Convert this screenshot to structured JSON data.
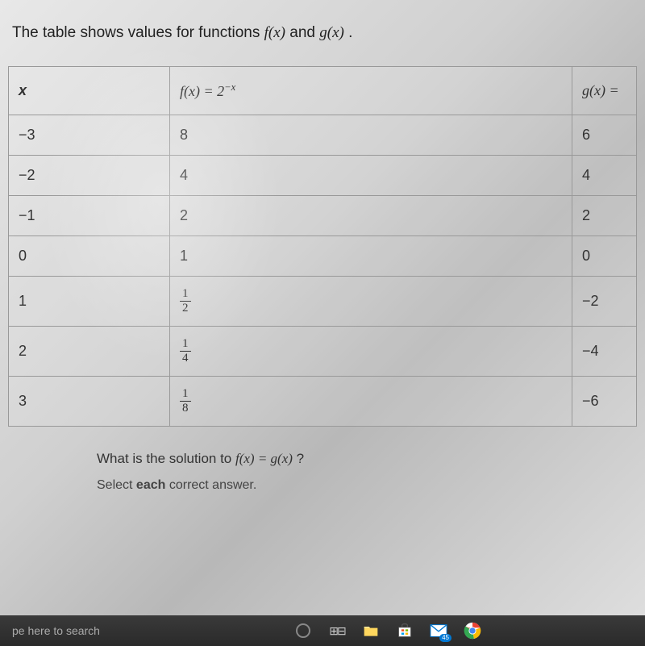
{
  "prompt": {
    "prefix": "The table shows values for functions ",
    "f": "f(x)",
    "and": " and ",
    "g": "g(x)",
    "suffix": " ."
  },
  "table": {
    "headers": {
      "x": "x",
      "fx_base": "f(x) = 2",
      "fx_exp": "−x",
      "gx": "g(x) ="
    },
    "rows": [
      {
        "x": "−3",
        "fx": "8",
        "gx": "6"
      },
      {
        "x": "−2",
        "fx": "4",
        "gx": "4"
      },
      {
        "x": "−1",
        "fx": "2",
        "gx": "2"
      },
      {
        "x": "0",
        "fx": "1",
        "gx": "0"
      },
      {
        "x": "1",
        "fx_frac": {
          "num": "1",
          "den": "2"
        },
        "gx": "−2"
      },
      {
        "x": "2",
        "fx_frac": {
          "num": "1",
          "den": "4"
        },
        "gx": "−4"
      },
      {
        "x": "3",
        "fx_frac": {
          "num": "1",
          "den": "8"
        },
        "gx": "−6"
      }
    ]
  },
  "question": {
    "prefix": "What is the solution to ",
    "equation": "f(x) = g(x)",
    "suffix": " ?"
  },
  "instruction": {
    "prefix": "Select ",
    "bold": "each",
    "suffix": " correct answer."
  },
  "taskbar": {
    "search": "pe here to search",
    "mail_badge": "45"
  },
  "chart_data": {
    "type": "table",
    "columns": [
      "x",
      "f(x) = 2^(-x)",
      "g(x)"
    ],
    "rows": [
      [
        -3,
        8,
        6
      ],
      [
        -2,
        4,
        4
      ],
      [
        -1,
        2,
        2
      ],
      [
        0,
        1,
        0
      ],
      [
        1,
        0.5,
        -2
      ],
      [
        2,
        0.25,
        -4
      ],
      [
        3,
        0.125,
        -6
      ]
    ]
  }
}
